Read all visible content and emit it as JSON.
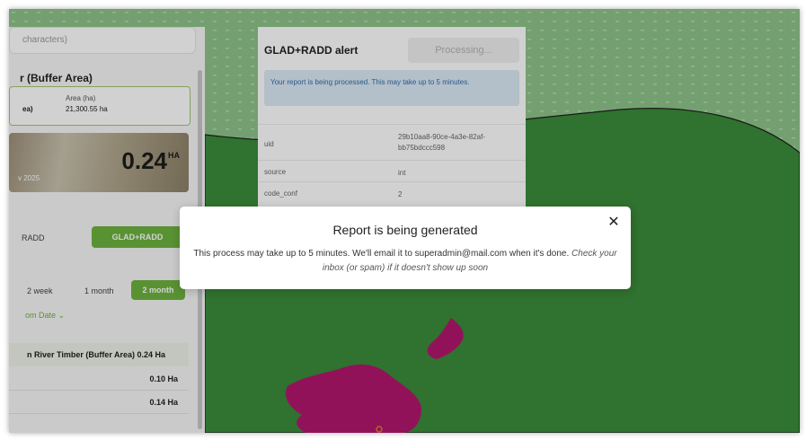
{
  "colors": {
    "accent": "#6db33f",
    "map_green": "#3b8c3a",
    "map_light": "#8ec48a",
    "alert_magenta": "#b3176e"
  },
  "sidebar": {
    "search_placeholder": "characters)",
    "area_title": "r (Buffer Area)",
    "info": {
      "area_label": "Area (ha)",
      "name_fragment": "ea)",
      "area_value": "21,300.55 ha"
    },
    "photo": {
      "area_value": "0.24",
      "area_unit": "HA",
      "date": "v 2025"
    },
    "tabs": {
      "radd": "RADD",
      "glad_radd": "GLAD+RADD"
    },
    "range": {
      "two_week": "2 week",
      "one_month": "1 month",
      "two_month": "2 month"
    },
    "custom_date": "om Date ⌄",
    "list": {
      "title": "n River Timber (Buffer Area) 0.24 Ha",
      "rows": [
        "0.10 Ha",
        "0.14 Ha"
      ]
    }
  },
  "panel": {
    "title": "GLAD+RADD alert",
    "button": "Processing...",
    "note": "Your report is being processed. This may take up to 5 minutes.",
    "rows": [
      {
        "key": "uid",
        "value": "29b10aa8-90ce-4a3e-82af-bb75bdccc598"
      },
      {
        "key": "source",
        "value": "int"
      },
      {
        "key": "code_conf",
        "value": "2"
      }
    ]
  },
  "modal": {
    "title": "Report is being generated",
    "close_icon": "close-icon",
    "body_prefix": "This process may take up to 5 minutes. We'll email it to superadmin@mail.com when it's done.",
    "body_italic": "Check your inbox (or spam) if it doesn't show up soon"
  }
}
